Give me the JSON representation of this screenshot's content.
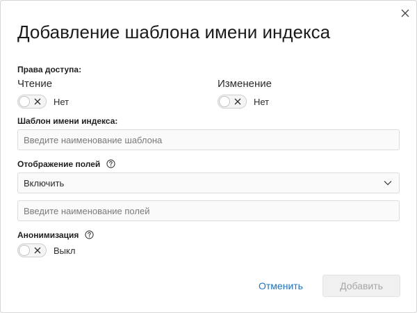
{
  "dialog": {
    "title": "Добавление шаблона имени индекса",
    "close_icon": "close-icon"
  },
  "access": {
    "label": "Права доступа:",
    "read": {
      "label": "Чтение",
      "state_text": "Нет",
      "enabled": false
    },
    "write": {
      "label": "Изменение",
      "state_text": "Нет",
      "enabled": false
    }
  },
  "index_template": {
    "label": "Шаблон имени индекса:",
    "value": "",
    "placeholder": "Введите наименование шаблона"
  },
  "field_display": {
    "label": "Отображение полей",
    "help_icon": "question-circle-icon",
    "selected": "Включить",
    "fields_value": "",
    "fields_placeholder": "Введите наименование полей"
  },
  "anonymization": {
    "label": "Анонимизация",
    "help_icon": "question-circle-icon",
    "state_text": "Выкл",
    "enabled": false
  },
  "footer": {
    "cancel_label": "Отменить",
    "add_label": "Добавить"
  },
  "colors": {
    "accent": "#1a73c8",
    "disabled_text": "#a6a6a6",
    "border": "#dcdcdc"
  }
}
